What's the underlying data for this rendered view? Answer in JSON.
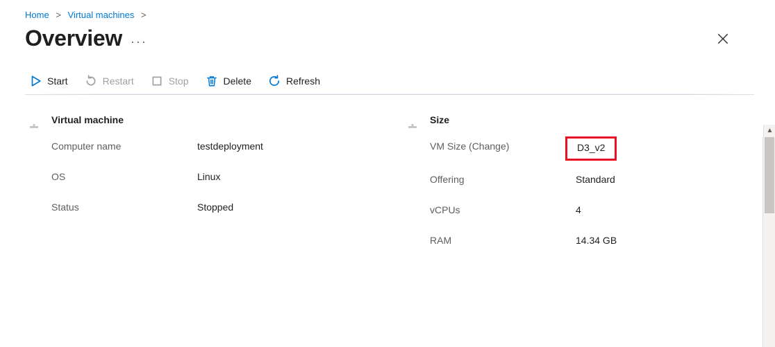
{
  "breadcrumb": {
    "items": [
      {
        "label": "Home"
      },
      {
        "label": "Virtual machines"
      }
    ]
  },
  "header": {
    "title": "Overview",
    "more_label": "···"
  },
  "toolbar": {
    "start": "Start",
    "restart": "Restart",
    "stop": "Stop",
    "delete": "Delete",
    "refresh": "Refresh"
  },
  "vm": {
    "section_title": "Virtual machine",
    "rows": {
      "computer_name": {
        "label": "Computer name",
        "value": "testdeployment"
      },
      "os": {
        "label": "OS",
        "value": "Linux"
      },
      "status": {
        "label": "Status",
        "value": "Stopped"
      }
    }
  },
  "size": {
    "section_title": "Size",
    "rows": {
      "vm_size": {
        "label_pre": "VM Size (",
        "change": "Change",
        "label_post": ")",
        "value": "D3_v2"
      },
      "offering": {
        "label": "Offering",
        "value": "Standard"
      },
      "vcpus": {
        "label": "vCPUs",
        "value": "4"
      },
      "ram": {
        "label": "RAM",
        "value": "14.34 GB"
      }
    }
  },
  "colors": {
    "accent": "#0078d4",
    "danger": "#e81123"
  }
}
